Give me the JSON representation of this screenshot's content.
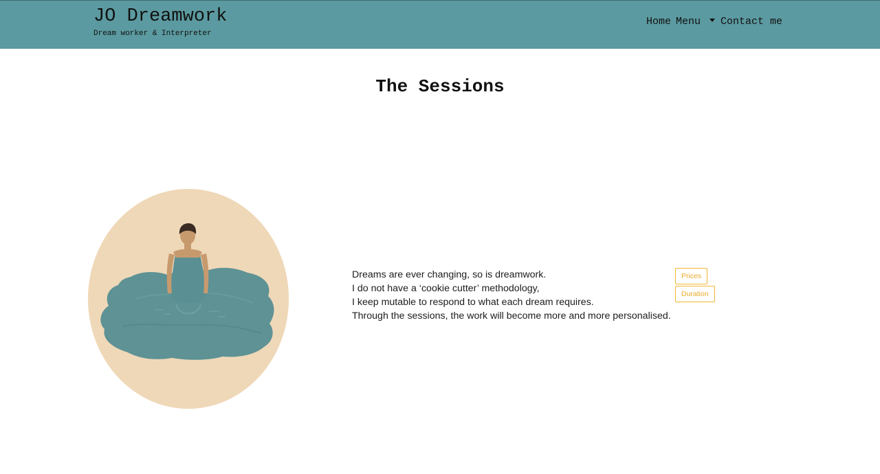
{
  "header": {
    "brand_title": "JO Dreamwork",
    "brand_subtitle": "Dream worker & Interpreter",
    "nav": {
      "home": "Home",
      "menu": "Menu",
      "contact": "Contact me"
    }
  },
  "main": {
    "title": "The Sessions",
    "paragraph_lines": [
      "Dreams are ever changing, so is dreamwork.",
      "I do not have a ‘cookie cutter’ methodology,",
      "I keep mutable to respond to what each dream requires.",
      "Through the sessions, the work will become more and more personalised."
    ],
    "buttons": {
      "prices": "Prices",
      "duration": "Duration"
    }
  },
  "colors": {
    "navbar": "#5b9aa0",
    "accent": "#f0b632",
    "illustration_bg": "#efd8b8",
    "water": "#5e9295"
  },
  "icons": {
    "menu_dropdown": "chevron-down-icon"
  }
}
